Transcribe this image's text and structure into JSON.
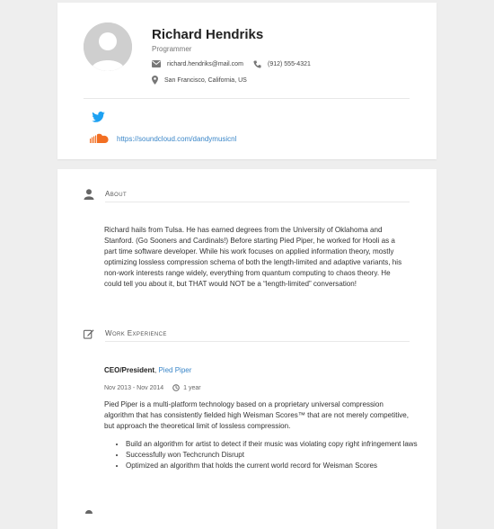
{
  "profile": {
    "name": "Richard Hendriks",
    "title": "Programmer",
    "email": "richard.hendriks@mail.com",
    "phone": "(912) 555-4321",
    "location": "San Francisco, California, US"
  },
  "social": {
    "soundcloud_url": "https://soundcloud.com/dandymusicnl"
  },
  "about": {
    "heading": "About",
    "text": "Richard hails from Tulsa. He has earned degrees from the University of Oklahoma and Stanford. (Go Sooners and Cardinals!) Before starting Pied Piper, he worked for Hooli as a part time software developer. While his work focuses on applied information theory, mostly optimizing lossless compression schema of both the length-limited and adaptive variants, his non-work interests range widely, everything from quantum computing to chaos theory. He could tell you about it, but THAT would NOT be a “length-limited” conversation!"
  },
  "work": {
    "heading": "Work Experience",
    "position": "CEO/President",
    "company": "Pied Piper",
    "dates": "Nov 2013 - Nov 2014",
    "duration": "1 year",
    "summary": "Pied Piper is a multi-platform technology based on a proprietary universal compression algorithm that has consistently fielded high Weisman Scores™ that are not merely competitive, but approach the theoretical limit of lossless compression.",
    "highlights": [
      "Build an algorithm for artist to detect if their music was violating copy right infringement laws",
      "Successfully won Techcrunch Disrupt",
      "Optimized an algorithm that holds the current world record for Weisman Scores"
    ]
  },
  "colors": {
    "link": "#3a86c8",
    "twitter": "#1da1f2",
    "soundcloud": "#f26f23"
  }
}
